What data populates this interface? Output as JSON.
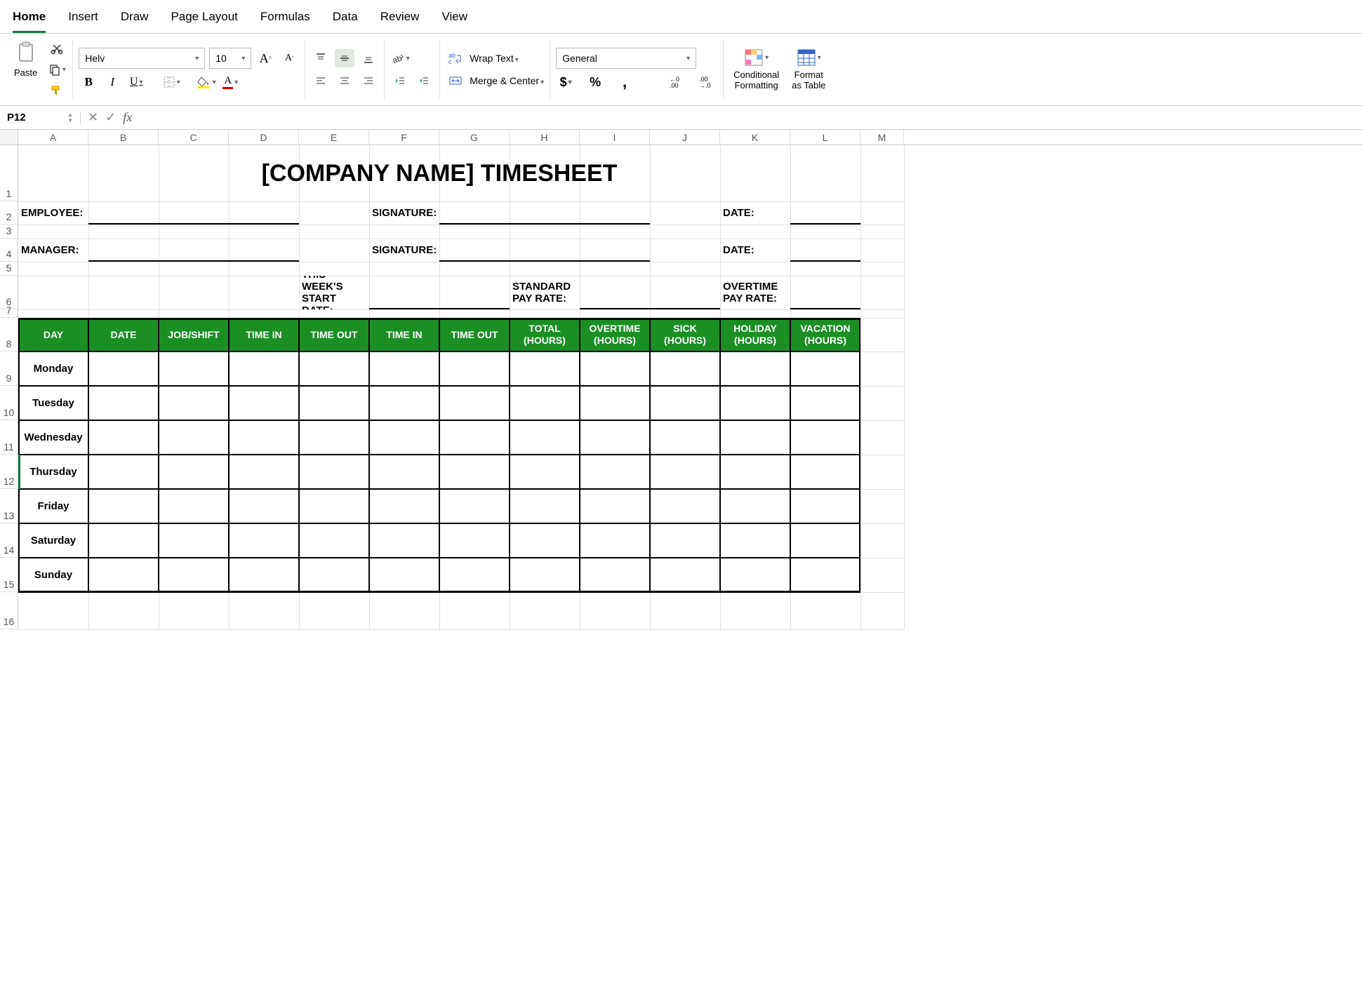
{
  "menu": {
    "tabs": [
      "Home",
      "Insert",
      "Draw",
      "Page Layout",
      "Formulas",
      "Data",
      "Review",
      "View"
    ],
    "active": 0
  },
  "ribbon": {
    "paste": "Paste",
    "font_name": "Helv",
    "font_size": "10",
    "wrap_text": "Wrap Text",
    "merge_center": "Merge & Center",
    "number_format": "General",
    "cond_fmt_l1": "Conditional",
    "cond_fmt_l2": "Formatting",
    "fmt_tbl_l1": "Format",
    "fmt_tbl_l2": "as Table"
  },
  "formula": {
    "cell_ref": "P12",
    "value": ""
  },
  "columns": {
    "letters": [
      "A",
      "B",
      "C",
      "D",
      "E",
      "F",
      "G",
      "H",
      "I",
      "J",
      "K",
      "L",
      "M"
    ],
    "widths": [
      100,
      100,
      100,
      100,
      100,
      100,
      100,
      100,
      100,
      100,
      100,
      100,
      62
    ]
  },
  "rows": {
    "numbers": [
      "1",
      "2",
      "3",
      "4",
      "5",
      "6",
      "7",
      "8",
      "9",
      "10",
      "11",
      "12",
      "13",
      "14",
      "15",
      "16"
    ],
    "heights": [
      80,
      33,
      20,
      33,
      20,
      48,
      12,
      48,
      49,
      49,
      49,
      49,
      49,
      49,
      49,
      53
    ]
  },
  "sheet": {
    "title": "[COMPANY NAME] TIMESHEET",
    "labels": {
      "employee": "EMPLOYEE:",
      "manager": "MANAGER:",
      "signature": "SIGNATURE:",
      "date": "DATE:",
      "week_start_l1": "THIS WEEK'S",
      "week_start_l2": "START DATE:",
      "std_rate_l1": "STANDARD",
      "std_rate_l2": "PAY RATE:",
      "ot_rate_l1": "OVERTIME",
      "ot_rate_l2": "PAY RATE:"
    },
    "ts_headers": [
      "DAY",
      "DATE",
      "JOB/SHIFT",
      "TIME IN",
      "TIME OUT",
      "TIME IN",
      "TIME OUT",
      "TOTAL (HOURS)",
      "OVERTIME (HOURS)",
      "SICK (HOURS)",
      "HOLIDAY (HOURS)",
      "VACATION (HOURS)"
    ],
    "days": [
      "Monday",
      "Tuesday",
      "Wednesday",
      "Thursday",
      "Friday",
      "Saturday",
      "Sunday"
    ]
  }
}
